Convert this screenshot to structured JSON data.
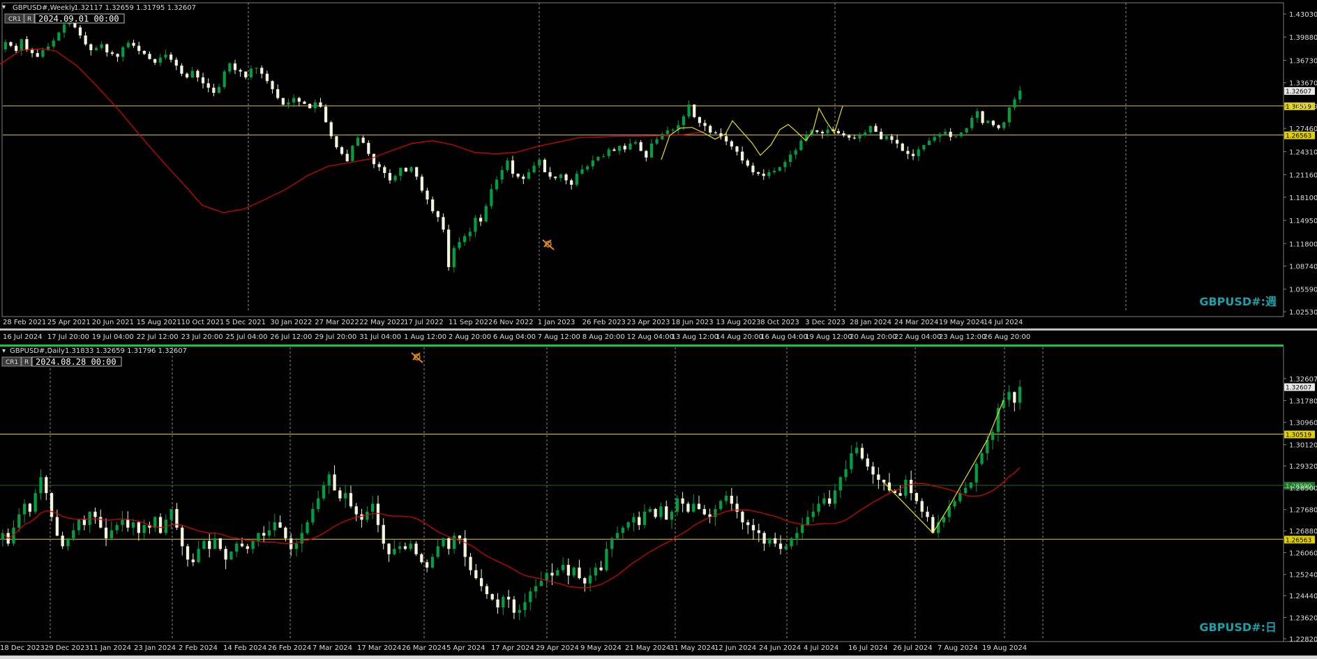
{
  "colors": {
    "background": "#000000",
    "bull": "#00A040",
    "bear": "#F5F5DC",
    "ma": "#E00000",
    "zigzag": "#F0E000",
    "hline": "#E0D000",
    "greenline": "#1E6A2E",
    "grid": "#909090",
    "axis_text": "#DCDCDC",
    "watermark": "#1AA0A8"
  },
  "weekly": {
    "title": "GBPUSD#,Weekly",
    "ohlc": "1.32117 1.32659 1.31795 1.32607",
    "btn1": "CR1",
    "btn2": "R",
    "datetime": "2024.09.01 00:00",
    "watermark": "GBPUSD#:週",
    "cursor_icon": "bulb-cursor-icon"
  },
  "daily": {
    "title": "GBPUSD#,Daily",
    "ohlc": "1.31833 1.32659 1.31796 1.32607",
    "btn1": "CR1",
    "btn2": "R",
    "datetime": "2024.08.28 00:00",
    "watermark": "GBPUSD#:日",
    "cursor_icon": "bulb-cursor-icon"
  },
  "chart_data": [
    {
      "type": "candlestick",
      "symbol": "GBPUSD#",
      "timeframe": "Weekly",
      "ylim": [
        1.0253,
        1.4303
      ],
      "y_ticks": [
        "1.43030",
        "1.39880",
        "1.36730",
        "1.33670",
        "1.30519",
        "1.27460",
        "1.24310",
        "1.21160",
        "1.18100",
        "1.14950",
        "1.11800",
        "1.08740",
        "1.05590",
        "1.02530"
      ],
      "x_ticks": [
        "28 Feb 2021",
        "25 Apr 2021",
        "20 Jun 2021",
        "15 Aug 2021",
        "10 Oct 2021",
        "5 Dec 2021",
        "30 Jan 2022",
        "27 Mar 2022",
        "22 May 2022",
        "17 Jul 2022",
        "11 Sep 2022",
        "6 Nov 2022",
        "1 Jan 2023",
        "26 Feb 2023",
        "23 Apr 2023",
        "18 Jun 2023",
        "13 Aug 2023",
        "8 Oct 2023",
        "3 Dec 2023",
        "28 Jan 2024",
        "24 Mar 2024",
        "19 May 2024",
        "14 Jul 2024"
      ],
      "x_ticks_lower": [
        "16 Jul 2024",
        "17 Jul 20:00",
        "19 Jul 04:00",
        "22 Jul 12:00",
        "23 Jul 20:00",
        "25 Jul 04:00",
        "26 Jul 12:00",
        "29 Jul 20:00",
        "31 Jul 04:00",
        "1 Aug 12:00",
        "2 Aug 20:00",
        "6 Aug 04:00",
        "7 Aug 12:00",
        "8 Aug 20:00",
        "12 Aug 04:00",
        "13 Aug 12:00",
        "14 Aug 20:00",
        "16 Aug 04:00",
        "19 Aug 12:00",
        "20 Aug 20:00",
        "22 Aug 04:00",
        "23 Aug 12:00",
        "26 Aug 20:00"
      ],
      "price_label": "1.32607",
      "hlines": [
        1.30519,
        1.26563
      ],
      "hline_labels": [
        "1.30519",
        "1.26563"
      ],
      "closes": [
        1.392,
        1.387,
        1.38,
        1.396,
        1.382,
        1.377,
        1.372,
        1.381,
        1.386,
        1.394,
        1.405,
        1.416,
        1.418,
        1.412,
        1.401,
        1.389,
        1.381,
        1.384,
        1.389,
        1.378,
        1.376,
        1.372,
        1.385,
        1.391,
        1.387,
        1.38,
        1.376,
        1.369,
        1.364,
        1.371,
        1.375,
        1.368,
        1.36,
        1.349,
        1.344,
        1.353,
        1.344,
        1.336,
        1.33,
        1.323,
        1.331,
        1.352,
        1.363,
        1.354,
        1.352,
        1.344,
        1.356,
        1.357,
        1.349,
        1.339,
        1.328,
        1.316,
        1.307,
        1.31,
        1.316,
        1.311,
        1.308,
        1.302,
        1.31,
        1.304,
        1.283,
        1.264,
        1.249,
        1.24,
        1.23,
        1.251,
        1.262,
        1.255,
        1.24,
        1.226,
        1.222,
        1.214,
        1.204,
        1.21,
        1.221,
        1.216,
        1.222,
        1.209,
        1.19,
        1.178,
        1.162,
        1.154,
        1.137,
        1.086,
        1.112,
        1.12,
        1.128,
        1.134,
        1.153,
        1.148,
        1.169,
        1.192,
        1.205,
        1.218,
        1.231,
        1.213,
        1.209,
        1.206,
        1.215,
        1.224,
        1.232,
        1.215,
        1.209,
        1.207,
        1.212,
        1.204,
        1.198,
        1.213,
        1.219,
        1.223,
        1.231,
        1.236,
        1.237,
        1.246,
        1.244,
        1.251,
        1.246,
        1.254,
        1.256,
        1.244,
        1.235,
        1.254,
        1.26,
        1.267,
        1.272,
        1.273,
        1.279,
        1.291,
        1.307,
        1.29,
        1.282,
        1.278,
        1.269,
        1.268,
        1.264,
        1.257,
        1.25,
        1.243,
        1.231,
        1.224,
        1.215,
        1.213,
        1.21,
        1.215,
        1.217,
        1.222,
        1.229,
        1.239,
        1.245,
        1.258,
        1.265,
        1.272,
        1.27,
        1.268,
        1.273,
        1.271,
        1.268,
        1.265,
        1.262,
        1.261,
        1.265,
        1.269,
        1.278,
        1.27,
        1.26,
        1.264,
        1.259,
        1.254,
        1.244,
        1.24,
        1.237,
        1.246,
        1.252,
        1.258,
        1.263,
        1.267,
        1.27,
        1.263,
        1.264,
        1.269,
        1.275,
        1.289,
        1.298,
        1.282,
        1.285,
        1.279,
        1.275,
        1.283,
        1.303,
        1.314,
        1.326
      ],
      "ma": [
        [
          0,
          1.362
        ],
        [
          30,
          1.381
        ],
        [
          60,
          1.383
        ],
        [
          80,
          1.38
        ],
        [
          110,
          1.36
        ],
        [
          140,
          1.331
        ],
        [
          170,
          1.3
        ],
        [
          200,
          1.266
        ],
        [
          230,
          1.233
        ],
        [
          260,
          1.202
        ],
        [
          290,
          1.17
        ],
        [
          320,
          1.16
        ],
        [
          350,
          1.165
        ],
        [
          380,
          1.178
        ],
        [
          410,
          1.192
        ],
        [
          440,
          1.21
        ],
        [
          470,
          1.223
        ],
        [
          500,
          1.228
        ],
        [
          530,
          1.233
        ],
        [
          560,
          1.244
        ],
        [
          590,
          1.254
        ],
        [
          620,
          1.258
        ],
        [
          650,
          1.252
        ],
        [
          680,
          1.242
        ],
        [
          710,
          1.24
        ],
        [
          740,
          1.242
        ],
        [
          770,
          1.25
        ],
        [
          800,
          1.256
        ],
        [
          830,
          1.262
        ],
        [
          860,
          1.263
        ],
        [
          890,
          1.264
        ],
        [
          920,
          1.264
        ],
        [
          950,
          1.265
        ],
        [
          980,
          1.266
        ],
        [
          1009,
          1.27
        ]
      ],
      "zigzag": [
        [
          948,
          1.232
        ],
        [
          960,
          1.265
        ],
        [
          975,
          1.275
        ],
        [
          992,
          1.276
        ],
        [
          1010,
          1.268
        ],
        [
          1025,
          1.26
        ],
        [
          1040,
          1.267
        ],
        [
          1050,
          1.285
        ],
        [
          1062,
          1.272
        ],
        [
          1078,
          1.255
        ],
        [
          1090,
          1.238
        ],
        [
          1105,
          1.252
        ],
        [
          1118,
          1.273
        ],
        [
          1130,
          1.28
        ],
        [
          1142,
          1.27
        ],
        [
          1155,
          1.258
        ],
        [
          1165,
          1.27
        ],
        [
          1174,
          1.302
        ],
        [
          1184,
          1.285
        ],
        [
          1196,
          1.268
        ],
        [
          1208,
          1.305
        ]
      ]
    },
    {
      "type": "candlestick",
      "symbol": "GBPUSD#",
      "timeframe": "Daily",
      "ylim": [
        1.2282,
        1.3326
      ],
      "y_ticks": [
        "1.32607",
        "1.31780",
        "1.30960",
        "1.30120",
        "1.29320",
        "1.28500",
        "1.27680",
        "1.26880",
        "1.26060",
        "1.25240",
        "1.24440",
        "1.23620",
        "1.22820"
      ],
      "x_ticks": [
        "18 Dec 2023",
        "29 Dec 2023",
        "11 Jan 2024",
        "23 Jan 2024",
        "2 Feb 2024",
        "14 Feb 2024",
        "26 Feb 2024",
        "7 Mar 2024",
        "17 Mar 2024",
        "26 Mar 2024",
        "5 Apr 2024",
        "17 Apr 2024",
        "29 Apr 2024",
        "9 May 2024",
        "21 May 2024",
        "31 May 2024",
        "12 Jun 2024",
        "24 Jun 2024",
        "4 Jul 2024",
        "16 Jul 2024",
        "26 Jul 2024",
        "7 Aug 2024",
        "19 Aug 2024"
      ],
      "price_label": "1.32607",
      "hlines": [
        1.30519,
        1.26563
      ],
      "hline_labels": [
        "1.30519",
        "1.26563"
      ],
      "green_line": 1.2859,
      "green_label": "1.28590",
      "closes": [
        1.268,
        1.264,
        1.27,
        1.275,
        1.279,
        1.276,
        1.283,
        1.289,
        1.283,
        1.274,
        1.267,
        1.263,
        1.266,
        1.269,
        1.273,
        1.271,
        1.276,
        1.274,
        1.27,
        1.266,
        1.269,
        1.271,
        1.273,
        1.27,
        1.272,
        1.268,
        1.271,
        1.27,
        1.274,
        1.268,
        1.273,
        1.277,
        1.27,
        1.263,
        1.258,
        1.257,
        1.262,
        1.265,
        1.262,
        1.266,
        1.262,
        1.258,
        1.261,
        1.264,
        1.263,
        1.262,
        1.265,
        1.268,
        1.267,
        1.269,
        1.272,
        1.27,
        1.266,
        1.262,
        1.264,
        1.268,
        1.272,
        1.277,
        1.281,
        1.286,
        1.29,
        1.284,
        1.281,
        1.283,
        1.278,
        1.275,
        1.273,
        1.276,
        1.279,
        1.271,
        1.264,
        1.26,
        1.262,
        1.263,
        1.262,
        1.264,
        1.26,
        1.257,
        1.255,
        1.259,
        1.263,
        1.266,
        1.262,
        1.267,
        1.266,
        1.259,
        1.254,
        1.251,
        1.248,
        1.245,
        1.243,
        1.24,
        1.244,
        1.243,
        1.238,
        1.239,
        1.242,
        1.246,
        1.248,
        1.25,
        1.253,
        1.252,
        1.254,
        1.256,
        1.252,
        1.255,
        1.251,
        1.249,
        1.252,
        1.255,
        1.254,
        1.262,
        1.266,
        1.268,
        1.27,
        1.272,
        1.274,
        1.271,
        1.276,
        1.277,
        1.274,
        1.278,
        1.273,
        1.276,
        1.281,
        1.279,
        1.276,
        1.279,
        1.277,
        1.275,
        1.274,
        1.277,
        1.28,
        1.282,
        1.279,
        1.276,
        1.272,
        1.271,
        1.269,
        1.268,
        1.264,
        1.266,
        1.264,
        1.262,
        1.263,
        1.266,
        1.268,
        1.271,
        1.274,
        1.276,
        1.279,
        1.281,
        1.279,
        1.284,
        1.289,
        1.292,
        1.298,
        1.3,
        1.296,
        1.293,
        1.29,
        1.288,
        1.287,
        1.284,
        1.283,
        1.282,
        1.288,
        1.283,
        1.28,
        1.276,
        1.274,
        1.268,
        1.272,
        1.274,
        1.278,
        1.28,
        1.283,
        1.285,
        1.287,
        1.294,
        1.298,
        1.303,
        1.306,
        1.315,
        1.318,
        1.321,
        1.317,
        1.323
      ]
    }
  ]
}
